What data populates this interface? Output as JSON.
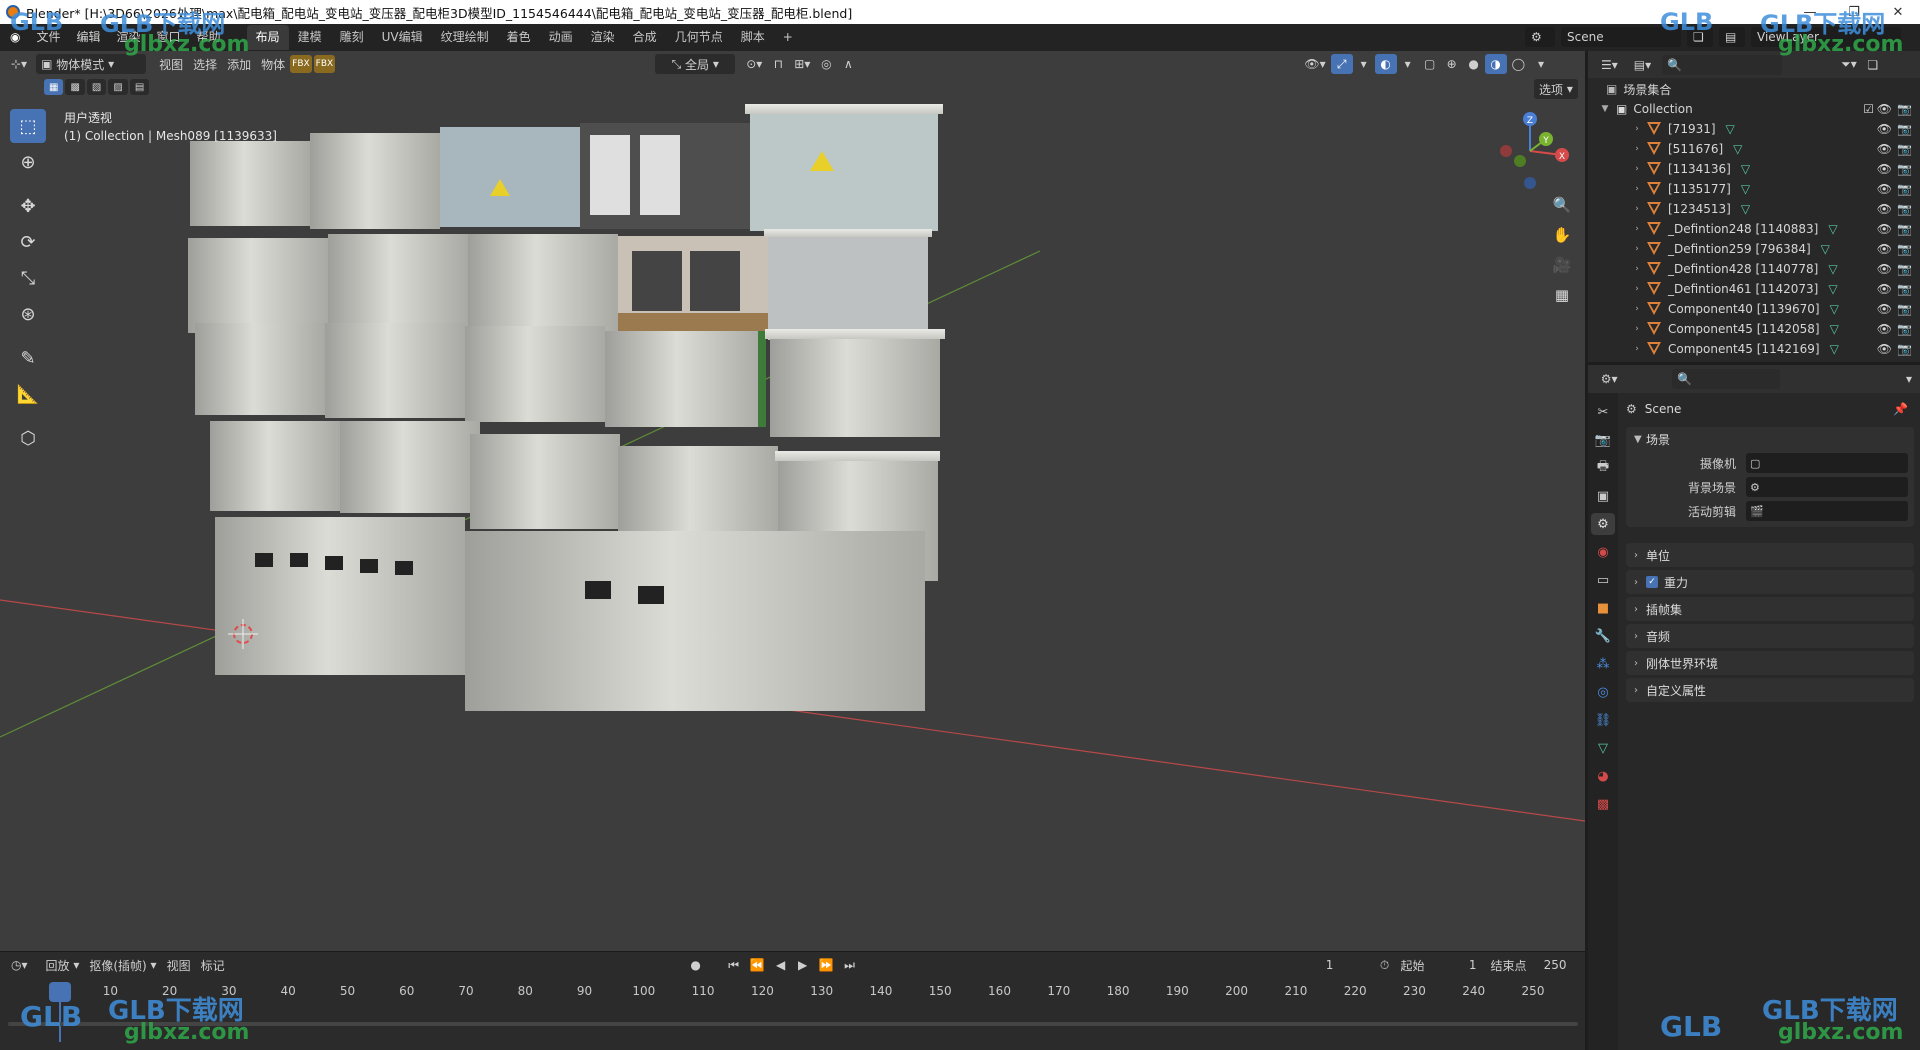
{
  "window": {
    "title": "Blender* [H:\\3D66\\2026处理\\max\\配电箱_配电站_变电站_变压器_配电柜3D模型ID_1154546444\\配电箱_配电站_变电站_变压器_配电柜.blend]",
    "min_glyph": "—",
    "max_glyph": "❐",
    "close_glyph": "✕"
  },
  "menubar": {
    "items": [
      "文件",
      "编辑",
      "渲染",
      "窗口",
      "帮助"
    ],
    "workspaces": [
      "布局",
      "建模",
      "雕刻",
      "UV编辑",
      "纹理绘制",
      "着色",
      "动画",
      "渲染",
      "合成",
      "几何节点",
      "脚本"
    ],
    "active_workspace_index": 0,
    "add_tab": "+",
    "scene_label": "Scene",
    "viewlayer_label": "ViewLayer"
  },
  "viewport": {
    "mode_label": "物体模式",
    "menus": [
      "视图",
      "选择",
      "添加",
      "物体"
    ],
    "transform_orientation": "全局",
    "options_label": "选项",
    "overlay_title": "用户透视",
    "overlay_subtitle": "(1) Collection | Mesh089 [1139633]",
    "fbx_badge": "FBX",
    "gizmo": {
      "x": "X",
      "y": "Y",
      "z": "Z"
    },
    "colors": {
      "background": "#3d3d3d",
      "x_axis": "#c94b4b",
      "y_axis": "#6a9a3a"
    }
  },
  "timeline": {
    "menus": [
      "回放",
      "抠像(插帧)",
      "视图",
      "标记"
    ],
    "current_frame": "1",
    "start_label": "起始",
    "start_value": "1",
    "end_label": "结束点",
    "end_value": "250",
    "ticks": [
      "1",
      "10",
      "20",
      "30",
      "40",
      "50",
      "60",
      "70",
      "80",
      "90",
      "100",
      "110",
      "120",
      "130",
      "140",
      "150",
      "160",
      "170",
      "180",
      "190",
      "200",
      "210",
      "220",
      "230",
      "240",
      "250"
    ]
  },
  "outliner": {
    "scene_collection": "场景集合",
    "collection": "Collection",
    "objects": [
      "[71931]",
      "[511676]",
      "[1134136]",
      "[1135177]",
      "[1234513]",
      "_Defintion248 [1140883]",
      "_Defintion259 [796384]",
      "_Defintion428 [1140778]",
      "_Defintion461 [1142073]",
      "Component40 [1139670]",
      "Component45 [1142058]",
      "Component45 [1142169]"
    ]
  },
  "properties": {
    "context_name": "Scene",
    "scene_panel": {
      "title": "场景",
      "camera_label": "摄像机",
      "background_label": "背景场景",
      "clip_label": "活动剪辑"
    },
    "collapsed_panels": [
      "单位",
      "重力",
      "插帧集",
      "音频",
      "刚体世界环境",
      "自定义属性"
    ],
    "gravity_checked": true
  },
  "watermarks": {
    "brand": "GLB下载网",
    "site": "glbxz.com",
    "logo": "GLB"
  },
  "accent": "#4772b3"
}
